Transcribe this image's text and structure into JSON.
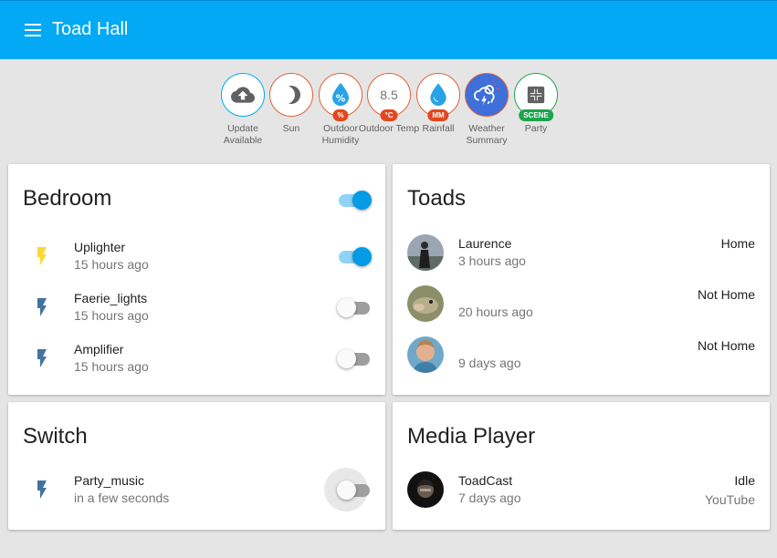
{
  "app": {
    "title": "Toad Hall"
  },
  "badges": [
    {
      "value": "",
      "unit": "",
      "label": "Update Available",
      "icon": "cloud-upload-icon"
    },
    {
      "value": "",
      "unit": "",
      "label": "Sun",
      "icon": "moon-icon"
    },
    {
      "value": "",
      "unit": "%",
      "label": "Outdoor Humidity",
      "icon": "water-percent-icon"
    },
    {
      "value": "8.5",
      "unit": "°C",
      "label": "Outdoor Temp",
      "icon": ""
    },
    {
      "value": "",
      "unit": "MM",
      "label": "Rainfall",
      "icon": "water-drop-icon"
    },
    {
      "value": "",
      "unit": "",
      "label": "Weather Summary",
      "icon": "weather-lightning-rainy-icon"
    },
    {
      "value": "",
      "unit": "SCENE",
      "label": "Party",
      "icon": "scene-icon"
    }
  ],
  "cards": {
    "bedroom": {
      "title": "Bedroom",
      "master_on": true,
      "rows": [
        {
          "name": "Uplighter",
          "time": "15 hours ago",
          "on": true,
          "icon": "flash-icon",
          "icon_color": "#fdd835"
        },
        {
          "name": "Faerie_lights",
          "time": "15 hours ago",
          "on": false,
          "icon": "flash-icon",
          "icon_color": "#44739e"
        },
        {
          "name": "Amplifier",
          "time": "15 hours ago",
          "on": false,
          "icon": "flash-icon",
          "icon_color": "#44739e"
        }
      ]
    },
    "toads": {
      "title": "Toads",
      "rows": [
        {
          "name": "Laurence",
          "time": "3 hours ago",
          "state": "Home"
        },
        {
          "name": "",
          "time": "20 hours ago",
          "state": "Not Home"
        },
        {
          "name": "",
          "time": "9 days ago",
          "state": "Not Home"
        }
      ]
    },
    "switch": {
      "title": "Switch",
      "rows": [
        {
          "name": "Party_music",
          "time": "in a few seconds",
          "on": false,
          "icon": "flash-icon",
          "icon_color": "#44739e"
        }
      ]
    },
    "media": {
      "title": "Media Player",
      "rows": [
        {
          "name": "ToadCast",
          "time": "7 days ago",
          "state": "Idle",
          "source": "YouTube"
        }
      ]
    }
  },
  "colors": {
    "toolbar": "#03a9f4",
    "accent": "#039be5",
    "badge_unit": "#e2481f",
    "scene_unit": "#1fa34d",
    "state_icon": "#44739e",
    "active_icon": "#fdd835"
  }
}
